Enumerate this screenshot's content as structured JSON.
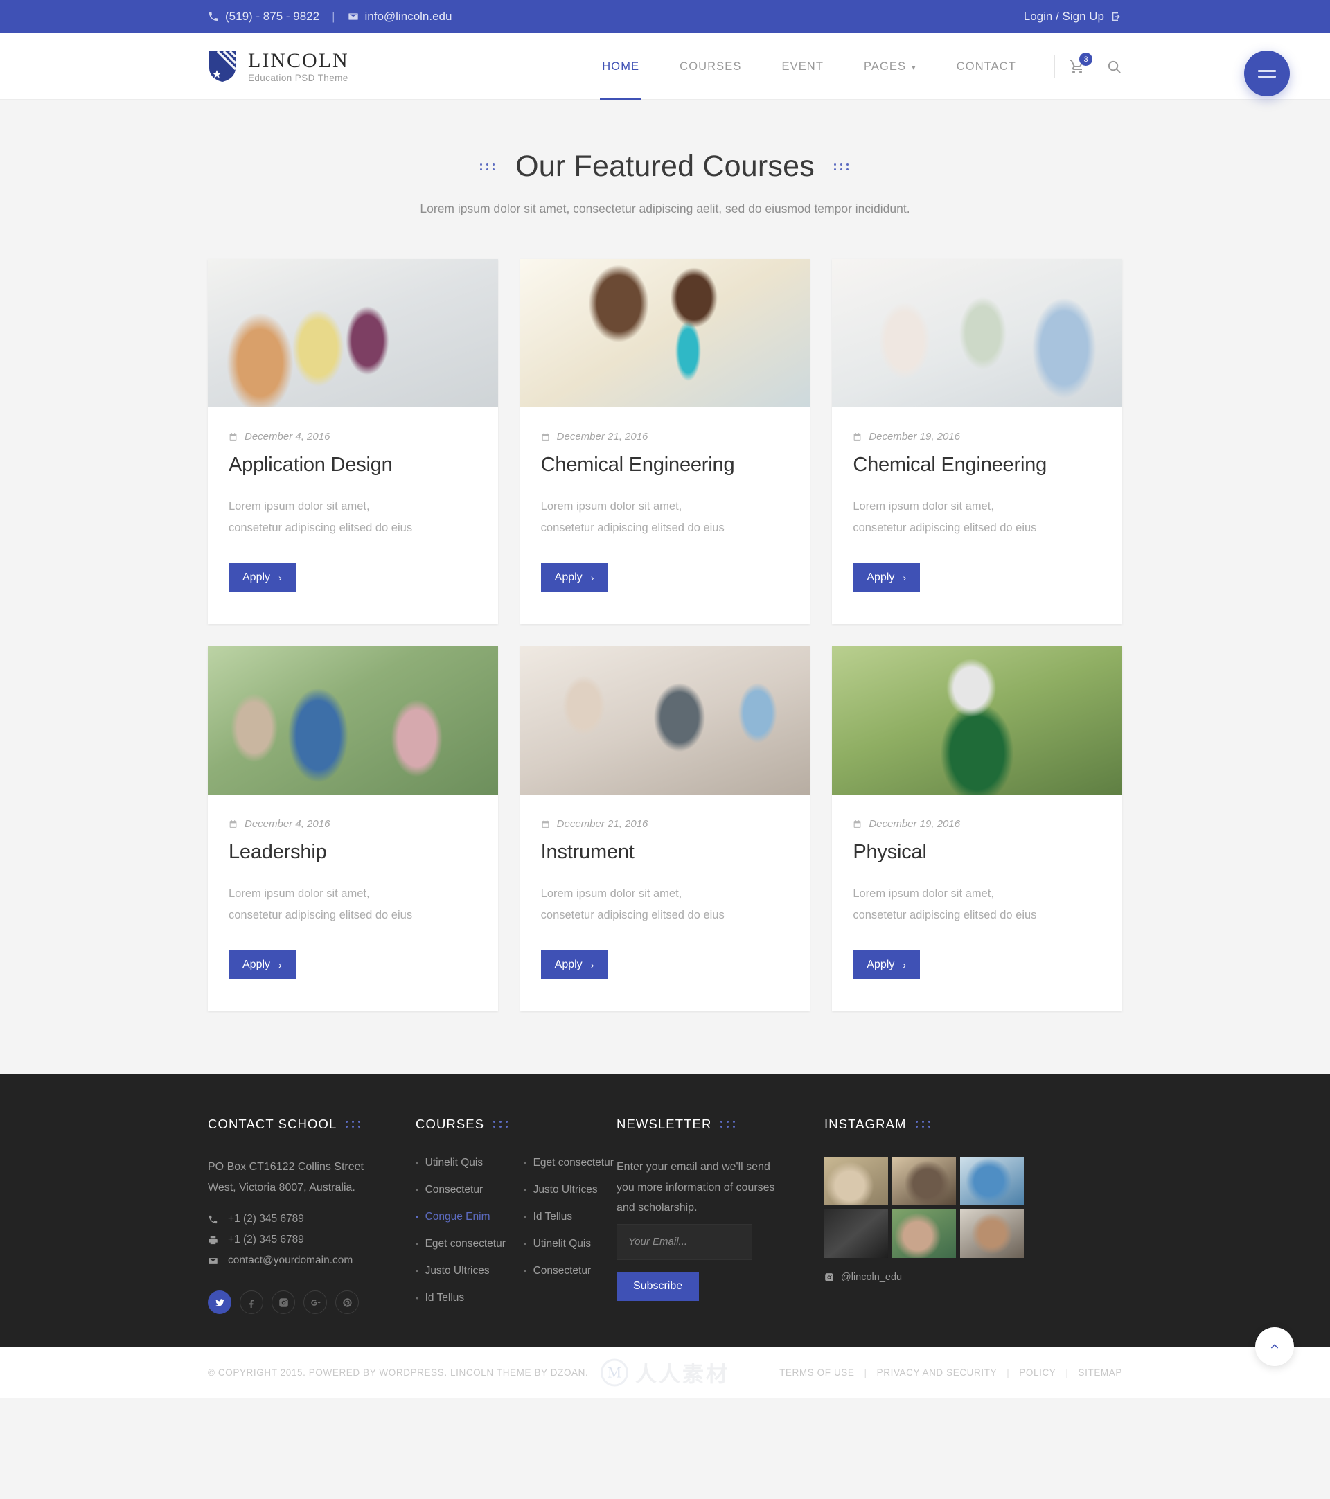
{
  "topbar": {
    "phone": "(519) - 875 - 9822",
    "separator": "|",
    "email": "info@lincoln.edu",
    "account": "Login / Sign Up"
  },
  "brand": {
    "name": "LINCOLN",
    "tagline": "Education PSD Theme"
  },
  "nav": {
    "items": [
      {
        "label": "HOME",
        "active": true,
        "caret": false
      },
      {
        "label": "COURSES",
        "active": false,
        "caret": false
      },
      {
        "label": "EVENT",
        "active": false,
        "caret": false
      },
      {
        "label": "PAGES",
        "active": false,
        "caret": true
      },
      {
        "label": "CONTACT",
        "active": false,
        "caret": false
      }
    ],
    "cart_count": "3"
  },
  "section": {
    "title": "Our Featured Courses",
    "subtitle": "Lorem ipsum dolor sit amet, consectetur adipiscing aelit, sed do eiusmod tempor incididunt."
  },
  "courses": [
    {
      "date": "December 4, 2016",
      "title": "Application Design",
      "desc": "Lorem ipsum dolor sit amet, consetetur adipiscing elitsed do eius",
      "apply": "Apply"
    },
    {
      "date": "December 21, 2016",
      "title": "Chemical Engineering",
      "desc": "Lorem ipsum dolor sit amet, consetetur adipiscing elitsed do eius",
      "apply": "Apply"
    },
    {
      "date": "December 19, 2016",
      "title": "Chemical Engineering",
      "desc": "Lorem ipsum dolor sit amet, consetetur adipiscing elitsed do eius",
      "apply": "Apply"
    },
    {
      "date": "December 4, 2016",
      "title": "Leadership",
      "desc": "Lorem ipsum dolor sit amet, consetetur adipiscing elitsed do eius",
      "apply": "Apply"
    },
    {
      "date": "December 21, 2016",
      "title": "Instrument",
      "desc": "Lorem ipsum dolor sit amet, consetetur adipiscing elitsed do eius",
      "apply": "Apply"
    },
    {
      "date": "December 19, 2016",
      "title": "Physical",
      "desc": "Lorem ipsum dolor sit amet, consetetur adipiscing elitsed do eius",
      "apply": "Apply"
    }
  ],
  "footer": {
    "contact": {
      "title": "CONTACT SCHOOL",
      "address": "PO Box CT16122 Collins Street West, Victoria 8007, Australia.",
      "phone": "+1 (2) 345 6789",
      "fax": "+1 (2) 345 6789",
      "email": "contact@yourdomain.com",
      "socials": [
        "twitter-icon",
        "facebook-icon",
        "instagram-icon",
        "google-plus-icon",
        "pinterest-icon"
      ]
    },
    "courses": {
      "title": "COURSES",
      "col1": [
        {
          "label": "Utinelit Quis",
          "highlight": false
        },
        {
          "label": "Consectetur",
          "highlight": false
        },
        {
          "label": "Congue Enim",
          "highlight": true
        },
        {
          "label": "Eget consectetur",
          "highlight": false
        },
        {
          "label": "Justo Ultrices",
          "highlight": false
        },
        {
          "label": "Id Tellus",
          "highlight": false
        }
      ],
      "col2": [
        {
          "label": "Eget consectetur",
          "highlight": false
        },
        {
          "label": "Justo Ultrices",
          "highlight": false
        },
        {
          "label": "Id Tellus",
          "highlight": false
        },
        {
          "label": "Utinelit Quis",
          "highlight": false
        },
        {
          "label": "Consectetur",
          "highlight": false
        }
      ]
    },
    "newsletter": {
      "title": "NEWSLETTER",
      "text": "Enter your email and we'll send you more information of courses and scholarship.",
      "placeholder": "Your Email...",
      "value": "",
      "button": "Subscribe"
    },
    "instagram": {
      "title": "INSTAGRAM",
      "handle": "@lincoln_edu"
    }
  },
  "bottombar": {
    "copyright": "© COPYRIGHT 2015. POWERED BY WORDPRESS. LINCOLN THEME BY DZOAN.",
    "links": [
      "TERMS OF USE",
      "PRIVACY AND SECURITY",
      "POLICY",
      "SITEMAP"
    ],
    "separator": "|",
    "watermark": "人人素材"
  },
  "colors": {
    "accent": "#3f51b5",
    "footer_bg": "#232323",
    "page_bg": "#f4f4f4"
  }
}
